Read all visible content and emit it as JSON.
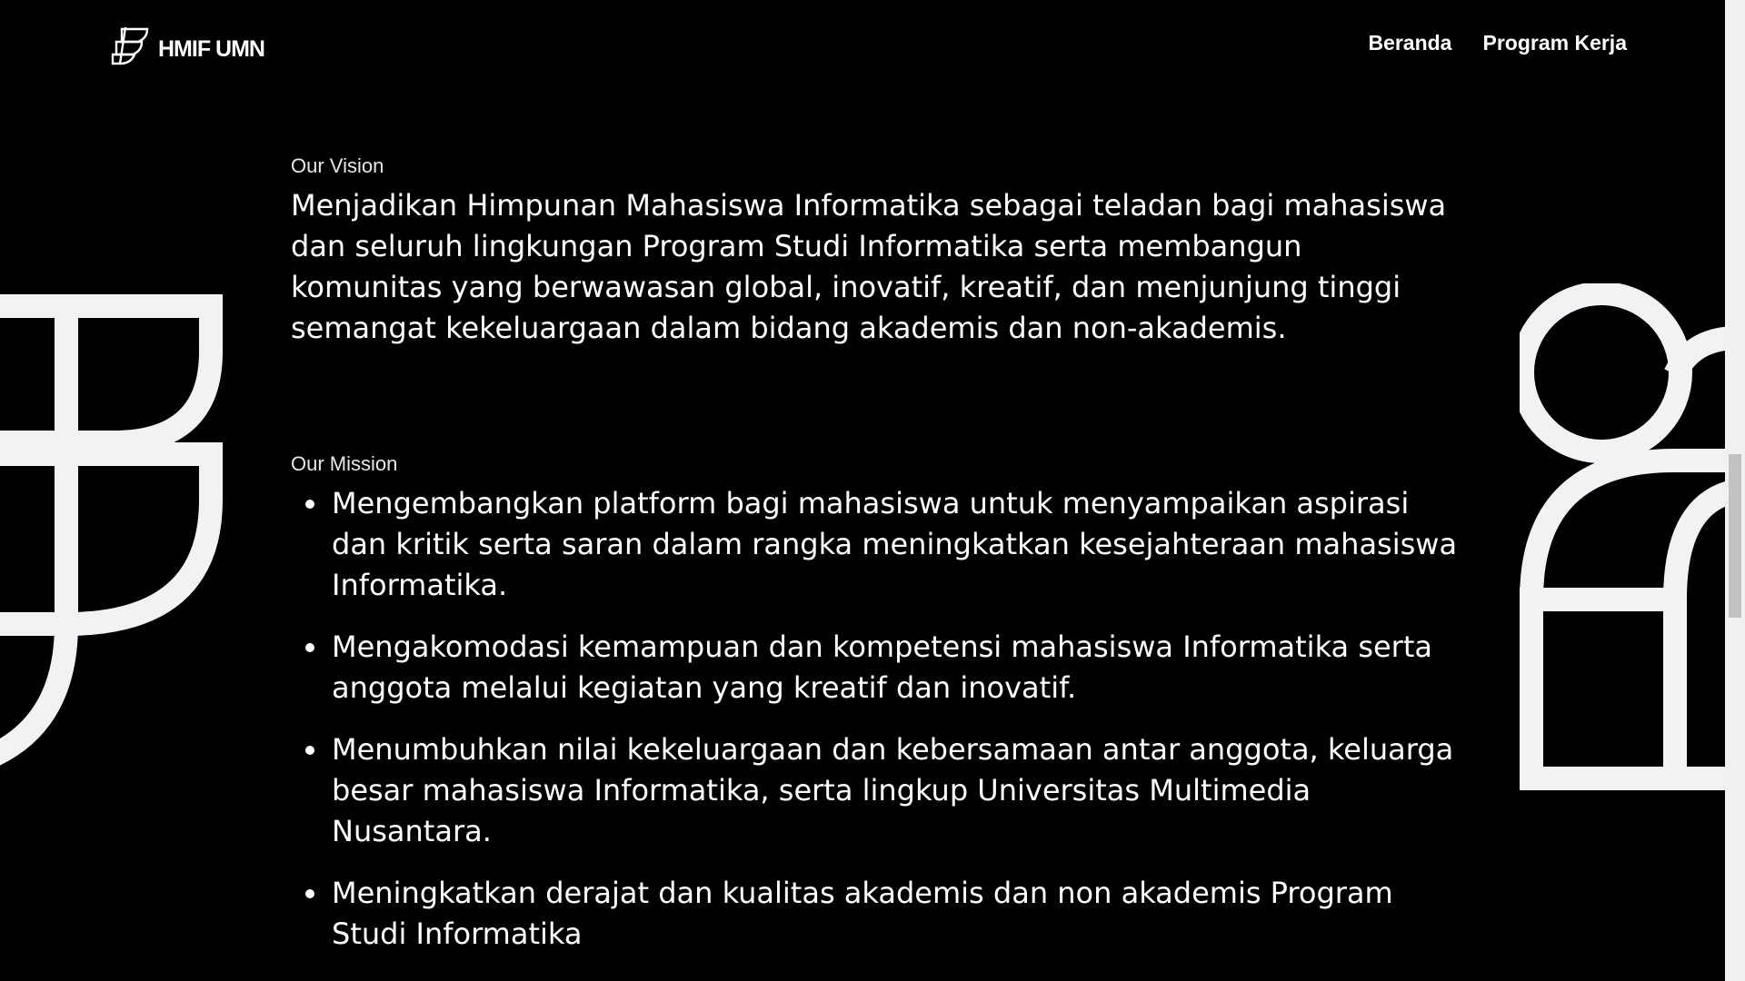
{
  "header": {
    "logo_text": "HMIF UMN",
    "nav": [
      {
        "label": "Beranda"
      },
      {
        "label": "Program Kerja"
      }
    ]
  },
  "vision": {
    "label": "Our Vision",
    "text": "Menjadikan Himpunan Mahasiswa Informatika sebagai teladan bagi mahasiswa dan seluruh lingkungan Program Studi Informatika serta membangun komunitas yang berwawasan global, inovatif, kreatif, dan menjunjung tinggi semangat kekeluargaan dalam bidang akademis dan non-akademis."
  },
  "mission": {
    "label": "Our Mission",
    "items": [
      "Mengembangkan platform bagi mahasiswa untuk menyampaikan aspirasi dan kritik serta saran dalam rangka meningkatkan kesejahteraan mahasiswa Informatika.",
      "Mengakomodasi kemampuan dan kompetensi mahasiswa Informatika serta anggota melalui kegiatan yang kreatif dan inovatif.",
      "Menumbuhkan nilai kekeluargaan dan kebersamaan antar anggota, keluarga besar mahasiswa Informatika, serta lingkup Universitas Multimedia Nusantara.",
      "Meningkatkan derajat dan kualitas akademis dan non akademis Program Studi Informatika"
    ]
  },
  "colors": {
    "background": "#000000",
    "text": "#ffffff",
    "decoration": "#f2f2f4"
  }
}
